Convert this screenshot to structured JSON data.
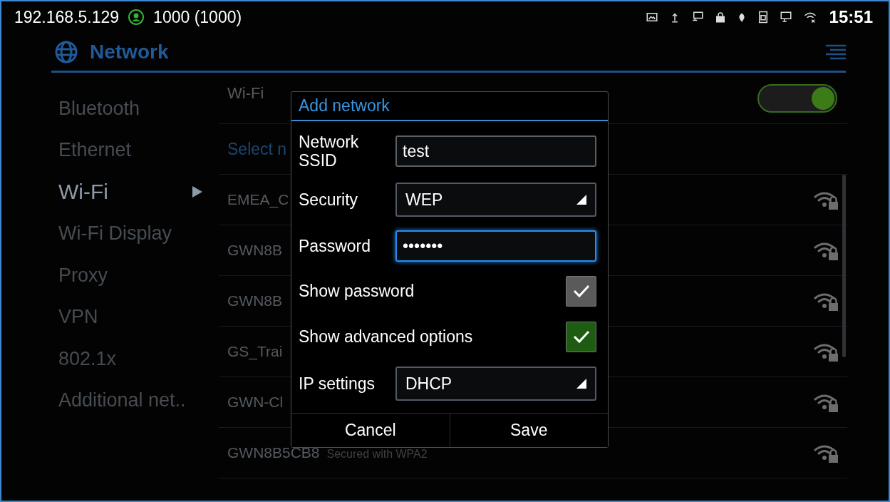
{
  "status_bar": {
    "ip": "192.168.5.129",
    "account": "1000 (1000)",
    "time": "15:51"
  },
  "header": {
    "title": "Network"
  },
  "sidebar": {
    "items": [
      {
        "label": "Bluetooth",
        "selected": false
      },
      {
        "label": "Ethernet",
        "selected": false
      },
      {
        "label": "Wi-Fi",
        "selected": true
      },
      {
        "label": "Wi-Fi Display",
        "selected": false
      },
      {
        "label": "Proxy",
        "selected": false
      },
      {
        "label": "VPN",
        "selected": false
      },
      {
        "label": "802.1x",
        "selected": false
      },
      {
        "label": "Additional net..",
        "selected": false
      }
    ]
  },
  "wifi": {
    "label": "Wi-Fi",
    "on": true
  },
  "section_label": "Select n",
  "networks": [
    {
      "name": "EMEA_C"
    },
    {
      "name": "GWN8B"
    },
    {
      "name": "GWN8B"
    },
    {
      "name": "GS_Trai"
    },
    {
      "name": "GWN-Cl"
    },
    {
      "name": "GWN8B5CB8",
      "security": "Secured with WPA2"
    }
  ],
  "dialog": {
    "title": "Add network",
    "fields": [
      {
        "kind": "text",
        "label": "Network SSID",
        "value": "test",
        "focused": false
      },
      {
        "kind": "select",
        "label": "Security",
        "value": "WEP"
      },
      {
        "kind": "text",
        "label": "Password",
        "value": "•••••••",
        "focused": true
      },
      {
        "kind": "checkbox",
        "label": "Show password",
        "checked": true,
        "color": "#5a5a5a"
      },
      {
        "kind": "checkbox",
        "label": "Show advanced options",
        "checked": true,
        "color": "#1e5c12"
      },
      {
        "kind": "select",
        "label": "IP settings",
        "value": "DHCP"
      }
    ],
    "buttons": [
      "Cancel",
      "Save"
    ]
  }
}
